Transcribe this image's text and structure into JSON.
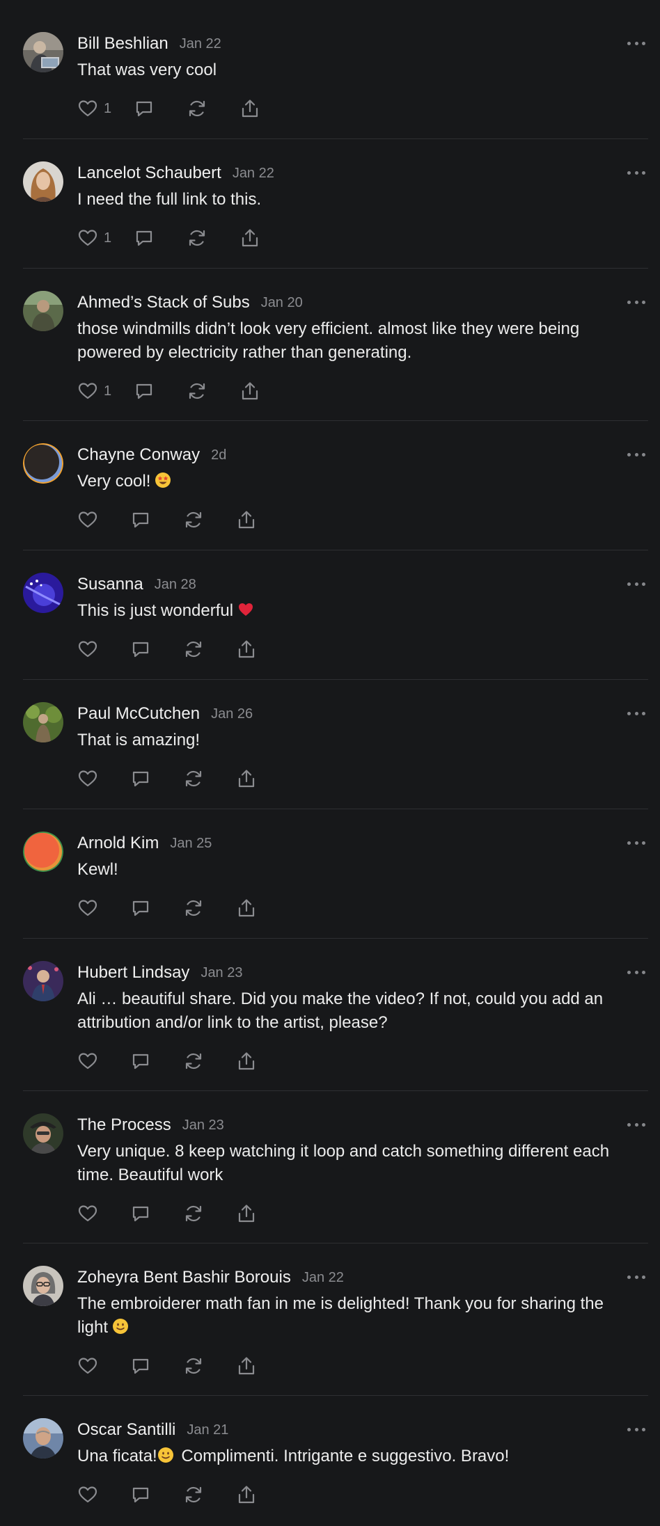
{
  "comments": [
    {
      "author": "Bill Beshlian",
      "date": "Jan 22",
      "text": "That was very cool",
      "likes": "1",
      "avatar": "photo-man-laptop"
    },
    {
      "author": "Lancelot Schaubert",
      "date": "Jan 22",
      "text": "I need the full link to this.",
      "likes": "1",
      "avatar": "photo-woman"
    },
    {
      "author": "Ahmed’s Stack of Subs",
      "date": "Jan 20",
      "text": "those windmills didn’t look very efficient. almost like they were being powered by electricity rather than generating.",
      "likes": "1",
      "avatar": "photo-man-outdoors"
    },
    {
      "author": "Chayne Conway",
      "date": "2d",
      "text": "Very cool!",
      "emoji": "star-struck",
      "likes": "",
      "avatar": "default-dark"
    },
    {
      "author": "Susanna",
      "date": "Jan 28",
      "text": "This is just wonderful",
      "emoji": "red-heart",
      "likes": "",
      "avatar": "photo-purple-concert"
    },
    {
      "author": "Paul McCutchen",
      "date": "Jan 26",
      "text": "That is amazing!",
      "likes": "",
      "avatar": "photo-garden"
    },
    {
      "author": "Arnold Kim",
      "date": "Jan 25",
      "text": "Kewl!",
      "likes": "",
      "avatar": "default-orange"
    },
    {
      "author": "Hubert Lindsay",
      "date": "Jan 23",
      "text": "Ali … beautiful share. Did you make the video? If not, could you add an attribution and/or link to the artist, please?",
      "likes": "",
      "avatar": "photo-man-suit"
    },
    {
      "author": "The Process",
      "date": "Jan 23",
      "text": "Very unique. 8 keep watching it loop and catch something different each time. Beautiful work",
      "likes": "",
      "avatar": "photo-man-hat"
    },
    {
      "author": "Zoheyra Bent Bashir Borouis",
      "date": "Jan 22",
      "text": "The embroiderer math fan in me is delighted! Thank you for sharing the light",
      "emoji": "slightly-smiling",
      "likes": "",
      "avatar": "photo-woman-glasses"
    },
    {
      "author": "Oscar Santilli",
      "date": "Jan 21",
      "text_before": "Una ficata!",
      "text_after": " Complimenti. Intrigante e suggestivo. Bravo!",
      "emoji": "slightly-smiling",
      "likes": "",
      "avatar": "photo-man-bald"
    }
  ],
  "colors": {
    "background": "#17181a",
    "divider": "#2e2f32",
    "muted": "#8b8c90",
    "text": "#ececec"
  },
  "icons": [
    "heart-icon",
    "comment-icon",
    "restack-icon",
    "share-icon",
    "more-icon"
  ]
}
